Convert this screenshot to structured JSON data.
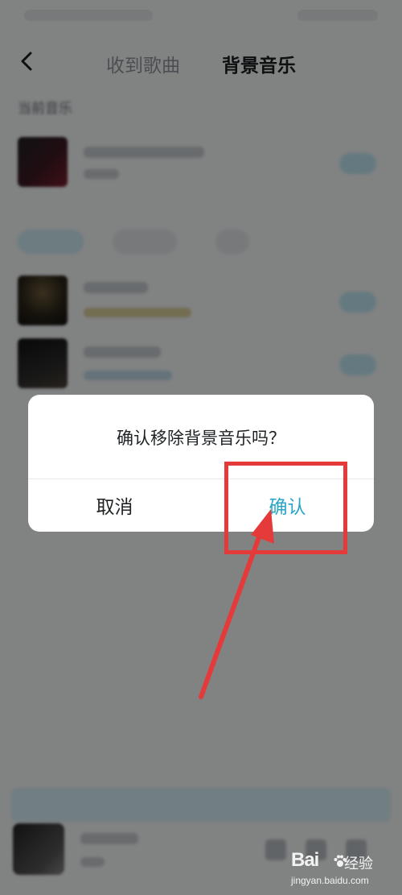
{
  "header": {
    "tabs": [
      {
        "label": "收到歌曲",
        "active": false
      },
      {
        "label": "背景音乐",
        "active": true
      }
    ]
  },
  "current_section": {
    "label": "当前音乐"
  },
  "dialog": {
    "message": "确认移除背景音乐吗？",
    "cancel_label": "取消",
    "confirm_label": "确认",
    "confirm_color": "#27a6c6"
  },
  "annotation": {
    "color": "#e53a3a"
  },
  "watermark": {
    "brand": "Bai",
    "jingyan": "经验",
    "url": "jingyan.baidu.com"
  },
  "icons": {
    "back": "chevron-left-icon",
    "paw": "baidu-paw-icon"
  }
}
